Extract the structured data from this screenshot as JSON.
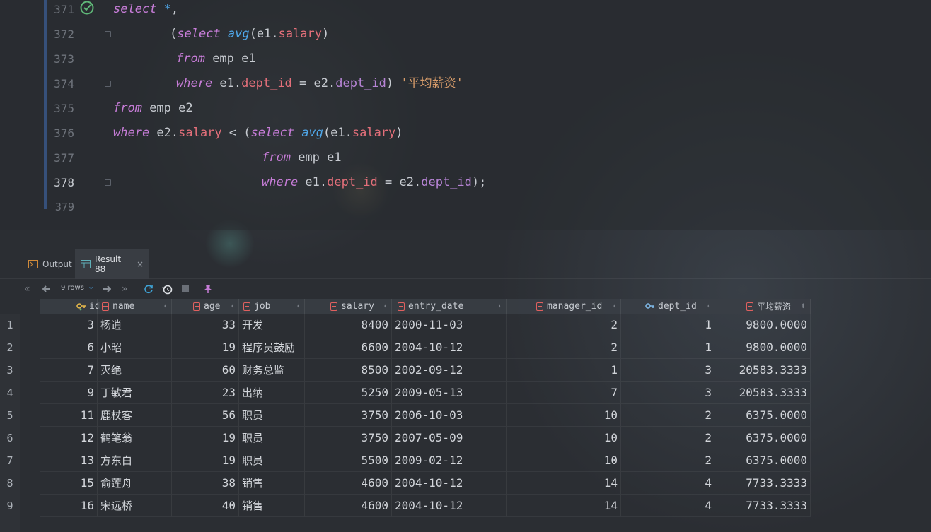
{
  "editor": {
    "lines": [
      {
        "num": "371"
      },
      {
        "num": "372"
      },
      {
        "num": "373"
      },
      {
        "num": "374"
      },
      {
        "num": "375"
      },
      {
        "num": "376"
      },
      {
        "num": "377"
      },
      {
        "num": "378"
      },
      {
        "num": "379"
      }
    ],
    "tokens": {
      "select": "select",
      "star": "*",
      "comma": ",",
      "open": "(",
      "avg": "avg",
      "arg": "(e1.",
      "salary": "salary",
      "close": ")",
      "from": "from",
      "emp_e1": " emp e1",
      "where": "where",
      "e1": " e1.",
      "dept_id": "dept_id",
      "eq": " = e2.",
      "alias_close": ")",
      "alias": " '平均薪资'",
      "emp_e2": " emp e2",
      "e2": " e2.",
      "lt": " < (",
      "semi": ");"
    }
  },
  "tabs": [
    {
      "label": "Output"
    },
    {
      "label": "Result 88",
      "close": "×"
    }
  ],
  "toolbar": {
    "rows": "9 rows",
    "chevron": "⌄"
  },
  "table": {
    "columns": [
      "id",
      "name",
      "age",
      "job",
      "salary",
      "entry_date",
      "manager_id",
      "dept_id",
      "平均薪资"
    ],
    "rows": [
      {
        "n": "1",
        "id": "3",
        "name": "杨逍",
        "age": "33",
        "job": "开发",
        "salary": "8400",
        "entry_date": "2000-11-03",
        "manager_id": "2",
        "dept_id": "1",
        "avg": "9800.0000"
      },
      {
        "n": "2",
        "id": "6",
        "name": "小昭",
        "age": "19",
        "job": "程序员鼓励",
        "salary": "6600",
        "entry_date": "2004-10-12",
        "manager_id": "2",
        "dept_id": "1",
        "avg": "9800.0000"
      },
      {
        "n": "3",
        "id": "7",
        "name": "灭绝",
        "age": "60",
        "job": "财务总监",
        "salary": "8500",
        "entry_date": "2002-09-12",
        "manager_id": "1",
        "dept_id": "3",
        "avg": "20583.3333"
      },
      {
        "n": "4",
        "id": "9",
        "name": "丁敏君",
        "age": "23",
        "job": "出纳",
        "salary": "5250",
        "entry_date": "2009-05-13",
        "manager_id": "7",
        "dept_id": "3",
        "avg": "20583.3333"
      },
      {
        "n": "5",
        "id": "11",
        "name": "鹿杖客",
        "age": "56",
        "job": "职员",
        "salary": "3750",
        "entry_date": "2006-10-03",
        "manager_id": "10",
        "dept_id": "2",
        "avg": "6375.0000"
      },
      {
        "n": "6",
        "id": "12",
        "name": "鹤笔翁",
        "age": "19",
        "job": "职员",
        "salary": "3750",
        "entry_date": "2007-05-09",
        "manager_id": "10",
        "dept_id": "2",
        "avg": "6375.0000"
      },
      {
        "n": "7",
        "id": "13",
        "name": "方东白",
        "age": "19",
        "job": "职员",
        "salary": "5500",
        "entry_date": "2009-02-12",
        "manager_id": "10",
        "dept_id": "2",
        "avg": "6375.0000"
      },
      {
        "n": "8",
        "id": "15",
        "name": "俞莲舟",
        "age": "38",
        "job": "销售",
        "salary": "4600",
        "entry_date": "2004-10-12",
        "manager_id": "14",
        "dept_id": "4",
        "avg": "7733.3333"
      },
      {
        "n": "9",
        "id": "16",
        "name": "宋远桥",
        "age": "40",
        "job": "销售",
        "salary": "4600",
        "entry_date": "2004-10-12",
        "manager_id": "14",
        "dept_id": "4",
        "avg": "7733.3333"
      }
    ]
  }
}
